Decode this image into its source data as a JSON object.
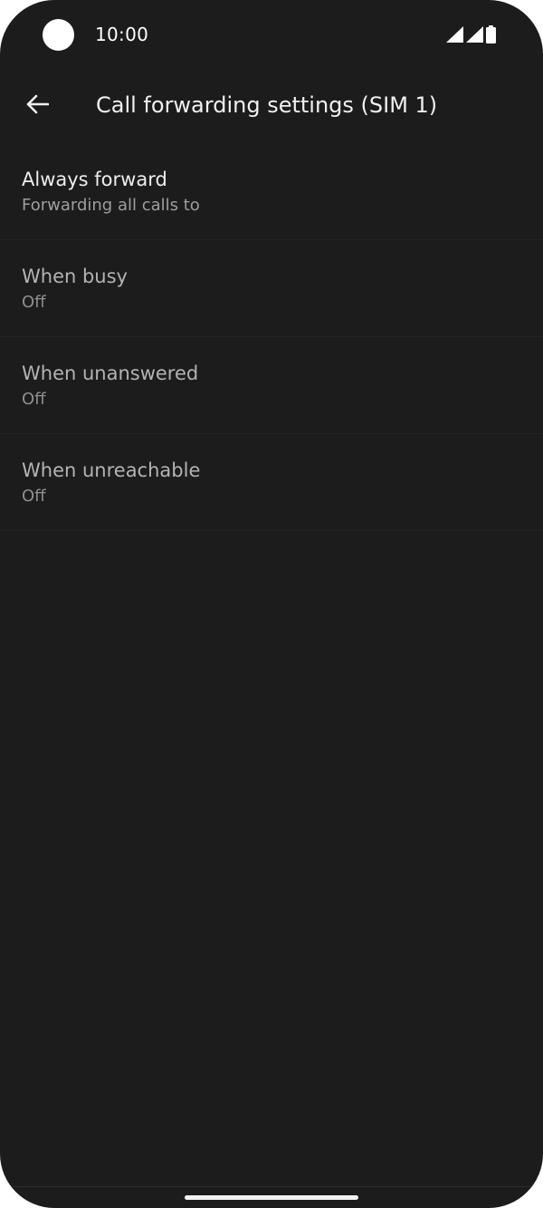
{
  "status_bar": {
    "time": "10:00",
    "icons": [
      "signal-icon",
      "signal-icon",
      "battery-icon"
    ]
  },
  "app_bar": {
    "back_icon": "arrow-back-icon",
    "title": "Call forwarding settings (SIM 1)"
  },
  "settings": [
    {
      "title": "Always forward",
      "summary": "Forwarding all calls to"
    },
    {
      "title": "When busy",
      "summary": "Off"
    },
    {
      "title": "When unanswered",
      "summary": "Off"
    },
    {
      "title": "When unreachable",
      "summary": "Off"
    }
  ],
  "colors": {
    "background": "#1c1c1c",
    "primary_text": "#ededed",
    "secondary_text": "#9e9e9e"
  }
}
